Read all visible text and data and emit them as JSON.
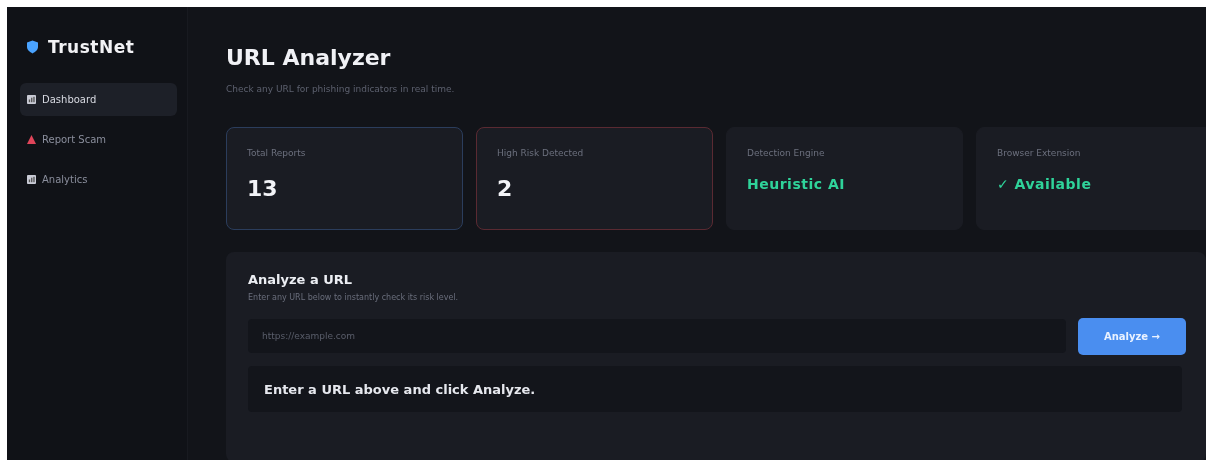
{
  "sidebar": {
    "brand": "TrustNet",
    "items": [
      {
        "label": "Dashboard",
        "kind": "chart",
        "selected": true
      },
      {
        "label": "Report Scam",
        "kind": "alert",
        "selected": false
      },
      {
        "label": "Analytics",
        "kind": "chart",
        "selected": false
      }
    ]
  },
  "header": {
    "title": "URL Analyzer",
    "subtitle": "Check any URL for phishing indicators in real time."
  },
  "stats": [
    {
      "label": "Total Reports",
      "value": "13",
      "kind": "count",
      "color": "#2b3d5c"
    },
    {
      "label": "High Risk Detected",
      "value": "2",
      "kind": "count",
      "color": "#5a2a32"
    },
    {
      "label": "Detection Engine",
      "value": "Heuristic AI",
      "kind": "status"
    },
    {
      "label": "Browser Extension",
      "value": "✓ Available",
      "kind": "status"
    }
  ],
  "analyze": {
    "title": "Analyze a URL",
    "hint": "Enter any URL below to instantly check its risk level.",
    "placeholder": "https://example.com",
    "button": "Analyze →",
    "result": "Enter a URL above and click Analyze."
  }
}
